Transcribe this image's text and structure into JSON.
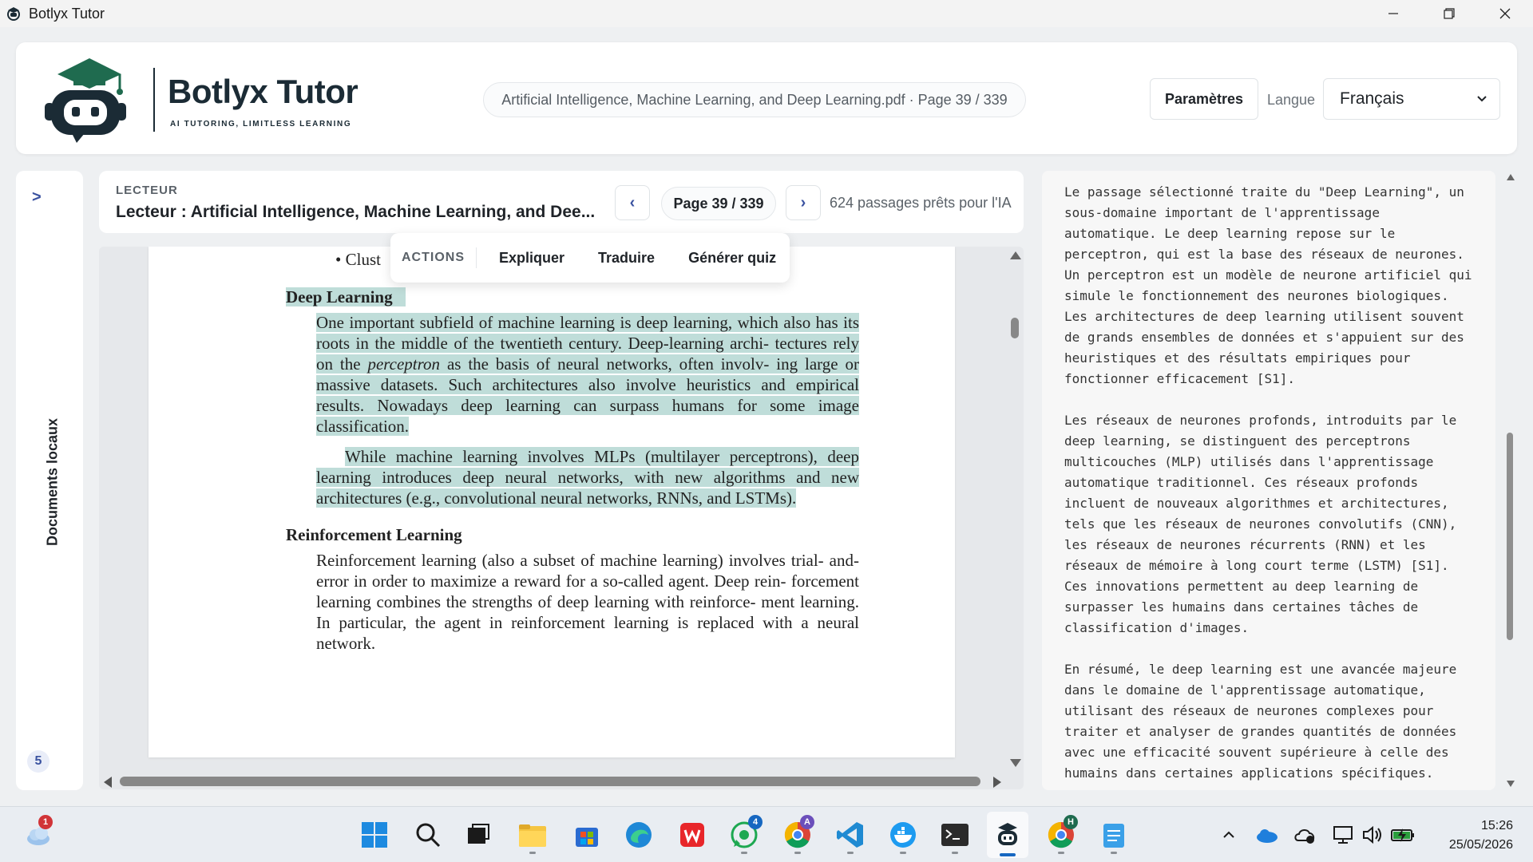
{
  "window": {
    "title": "Botlyx Tutor",
    "controls": {
      "minimize": "—",
      "maximize": "❐",
      "close": "✕"
    }
  },
  "header": {
    "brand_name": "Botlyx Tutor",
    "brand_tagline": "AI TUTORING, LIMITLESS LEARNING",
    "document_info": "Artificial Intelligence, Machine Learning, and Deep Learning.pdf · Page 39 / 339",
    "settings_label": "Paramètres",
    "language_label": "Langue",
    "language_value": "Français"
  },
  "sidebar": {
    "toggle": ">",
    "label": "Documents locaux",
    "count": "5"
  },
  "reader": {
    "kicker": "LECTEUR",
    "title": "Lecteur : Artificial Intelligence, Machine Learning, and Dee...",
    "prev": "‹",
    "next": "›",
    "page_indicator": "Page 39 / 339",
    "passages_status": "624 passages prêts pour l'IA"
  },
  "actions_popup": {
    "label": "ACTIONS",
    "items": [
      "Expliquer",
      "Traduire",
      "Générer quiz"
    ]
  },
  "pdf": {
    "bullet": "• Clust",
    "section1_title": "Deep Learning",
    "para1_a": "One important subfield of machine learning is deep learning, which also has its roots in the middle of the twentieth century. Deep-learning archi- tectures rely on the ",
    "para1_em": "perceptron",
    "para1_b": " as the basis of neural networks, often involv- ing large or massive datasets. Such architectures also involve heuristics and empirical results. Nowadays deep learning can surpass humans for some image classification.",
    "para2": "While machine learning involves MLPs (multilayer perceptrons), deep learning introduces deep neural networks, with new algorithms and new architectures (e.g., convolutional neural networks, RNNs, and LSTMs).",
    "section2_title": "Reinforcement Learning",
    "para3": "Reinforcement learning (also a subset of machine learning) involves trial- and-error in order to maximize a reward for a so-called agent. Deep rein- forcement learning combines the strengths of deep learning with reinforce- ment learning. In particular, the agent in reinforcement learning is replaced with a neural network."
  },
  "answer": {
    "text": "Le passage sélectionné traite du \"Deep Learning\", un sous-domaine important de l'apprentissage automatique. Le deep learning repose sur le perceptron, qui est la base des réseaux de neurones. Un perceptron est un modèle de neurone artificiel qui simule le fonctionnement des neurones biologiques. Les architectures de deep learning utilisent souvent de grands ensembles de données et s'appuient sur des heuristiques et des résultats empiriques pour fonctionner efficacement [S1].\n\nLes réseaux de neurones profonds, introduits par le deep learning, se distinguent des perceptrons multicouches (MLP) utilisés dans l'apprentissage automatique traditionnel. Ces réseaux profonds incluent de nouveaux algorithmes et architectures, tels que les réseaux de neurones convolutifs (CNN), les réseaux de neurones récurrents (RNN) et les réseaux de mémoire à long court terme (LSTM) [S1]. Ces innovations permettent au deep learning de surpasser les humains dans certaines tâches de classification d'images.\n\nEn résumé, le deep learning est une avancée majeure dans le domaine de l'apprentissage automatique, utilisant des réseaux de neurones complexes pour traiter et analyser de grandes quantités de données avec une efficacité souvent supérieure à celle des humains dans certaines applications spécifiques."
  },
  "taskbar": {
    "weather_badge": "1",
    "whatsapp_badge": "4",
    "chrome_profile_a": "A",
    "chrome_profile_h": "H",
    "time": "15:26",
    "date": "25/05/2026"
  },
  "colors": {
    "highlight": "#bfddd9",
    "brand_dark": "#1b2b35",
    "accent_blue": "#3a52a0",
    "taskbar_active": "#1667c1"
  }
}
